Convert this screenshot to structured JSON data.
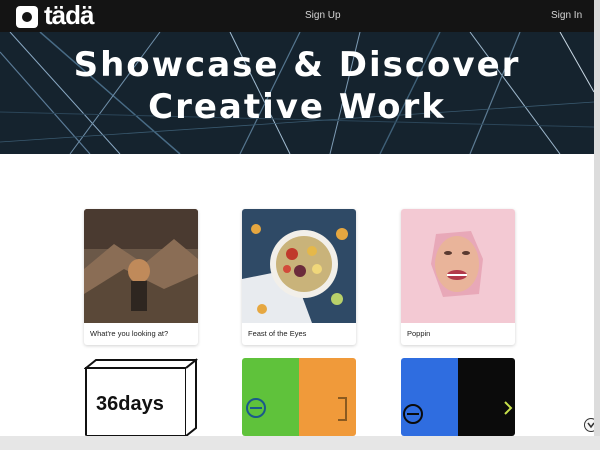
{
  "app": {
    "logo_text": "tädä"
  },
  "nav": {
    "signup": "Sign Up",
    "signin": "Sign In"
  },
  "hero": {
    "line1": "Showcase & Discover",
    "line2": "Creative Work"
  },
  "cards": [
    {
      "caption": "What're you looking at?"
    },
    {
      "caption": "Feast of the Eyes"
    },
    {
      "caption": "Poppin"
    },
    {
      "caption": "",
      "art_text": "36days"
    },
    {
      "caption": ""
    },
    {
      "caption": ""
    }
  ],
  "colors": {
    "topbar": "#141414",
    "green": "#5fc23b",
    "orange": "#f09a3a",
    "blue": "#2f6de0",
    "black": "#0b0b0b",
    "pink": "#f3c9d3"
  },
  "icons": {
    "scroll_button": "chevron-down-circle-icon"
  }
}
